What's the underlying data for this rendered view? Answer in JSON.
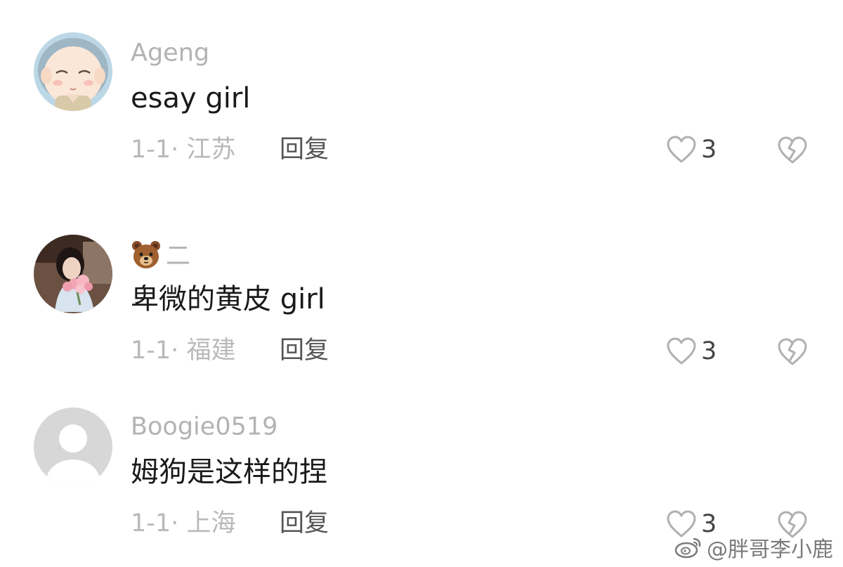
{
  "comments": [
    {
      "username": "Ageng",
      "name_emoji": "",
      "text": "esay girl",
      "date": "1-1",
      "location": "江苏",
      "reply_label": "回复",
      "likes": "3",
      "avatar": "monk-cartoon-avatar"
    },
    {
      "username": "二",
      "name_emoji": "bear-face-emoji",
      "text": "卑微的黄皮 girl",
      "date": "1-1",
      "location": "福建",
      "reply_label": "回复",
      "likes": "3",
      "avatar": "woman-with-flowers-photo"
    },
    {
      "username": "Boogie0519",
      "name_emoji": "",
      "text": "姆狗是这样的捏",
      "date": "1-1",
      "location": "上海",
      "reply_label": "回复",
      "likes": "3",
      "avatar": "default-user-avatar"
    }
  ],
  "meta_separator": "·",
  "watermark": {
    "text": "@胖哥李小鹿",
    "icon": "weibo-logo"
  },
  "colors": {
    "background": "#ffffff",
    "username": "#b3b3b3",
    "meta": "#b9b9b9",
    "reply": "#555555",
    "icon_stroke": "#b0b0b0"
  }
}
